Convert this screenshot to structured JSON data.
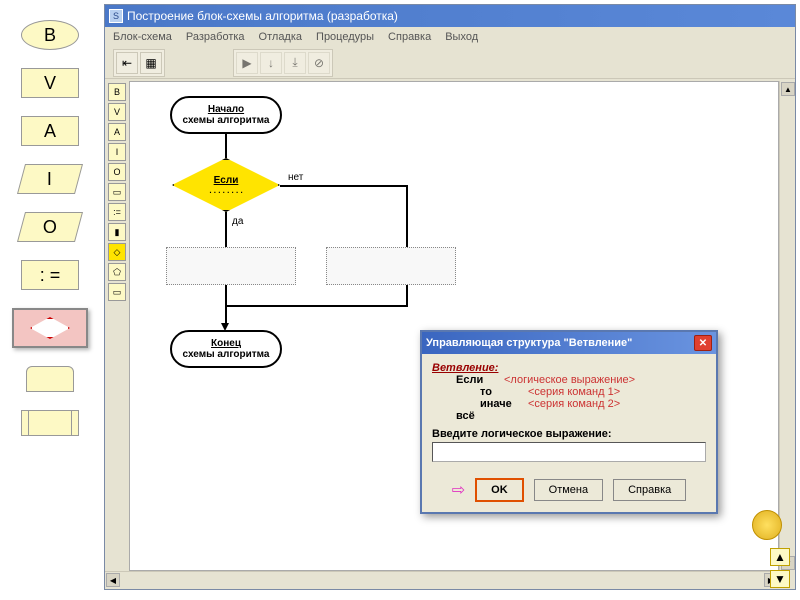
{
  "sidebar": {
    "b_label": "B",
    "v_label": "V",
    "a_label": "A",
    "i_label": "I",
    "o_label": "O",
    "assign_label": ": ="
  },
  "window": {
    "app_icon": "S",
    "title": "Построение блок-схемы алгоритма (разработка)"
  },
  "menu": {
    "blockscheme": "Блок-схема",
    "development": "Разработка",
    "debug": "Отладка",
    "procedures": "Процедуры",
    "help": "Справка",
    "exit": "Выход"
  },
  "palette": [
    "B",
    "V",
    "A",
    "I",
    "O",
    ":=",
    "◇",
    "⬠",
    "▭",
    "▭"
  ],
  "flow": {
    "start_t1": "Начало",
    "start_t2": "схемы алгоритма",
    "if_label": "Если",
    "if_dots": ". . . . . . . .",
    "no": "нет",
    "yes": "да",
    "end_t1": "Конец",
    "end_t2": "схемы алгоритма"
  },
  "dialog": {
    "title": "Управляющая структура  \"Ветвление\"",
    "heading": "Ветвление:",
    "kw_if": "Если",
    "ph_cond": "<логическое выражение>",
    "kw_then": "то",
    "ph_then": "<серия команд 1>",
    "kw_else": "иначе",
    "ph_else": "<серия команд 2>",
    "kw_all": "всё",
    "input_label": "Введите логическое выражение:",
    "input_value": "",
    "ok": "OK",
    "cancel": "Отмена",
    "help": "Справка"
  }
}
